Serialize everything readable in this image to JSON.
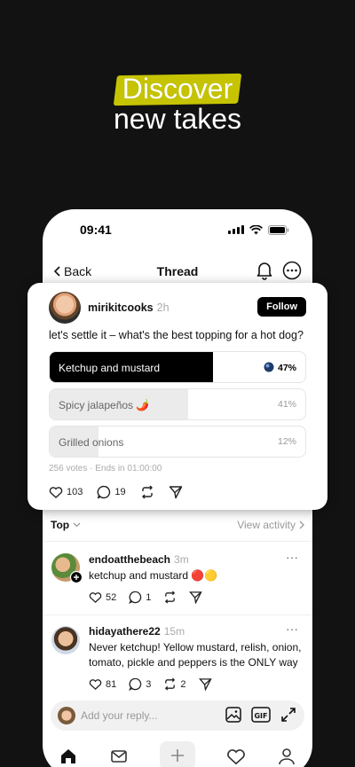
{
  "hero": {
    "line1": "Discover",
    "line2": "new takes"
  },
  "status_bar": {
    "time": "09:41"
  },
  "nav": {
    "back_label": "Back",
    "title": "Thread"
  },
  "post": {
    "author": "mirikitcooks",
    "age": "2h",
    "follow_label": "Follow",
    "question": "let's settle it – what's the best topping for a hot dog?",
    "options": [
      {
        "label": "Ketchup and mustard",
        "percent": "47%",
        "value": 47
      },
      {
        "label": "Spicy jalapeños 🌶️",
        "percent": "41%",
        "value": 41
      },
      {
        "label": "Grilled onions",
        "percent": "12%",
        "value": 12
      }
    ],
    "meta": "256 votes · Ends in 01:00:00",
    "likes": "103",
    "comments": "19"
  },
  "sort": {
    "label": "Top",
    "view_activity": "View activity"
  },
  "replies": [
    {
      "author": "endoatthebeach",
      "age": "3m",
      "text": "ketchup and mustard 🔴🟡",
      "likes": "52",
      "comments": "1",
      "reposts": ""
    },
    {
      "author": "hidayathere22",
      "age": "15m",
      "text": "Never ketchup! Yellow mustard, relish, onion, tomato, pickle and peppers is the ONLY way",
      "likes": "81",
      "comments": "3",
      "reposts": "2"
    }
  ],
  "reply_bar": {
    "placeholder": "Add your reply..."
  },
  "colors": {
    "highlight": "#e6e400",
    "background": "#121212"
  }
}
